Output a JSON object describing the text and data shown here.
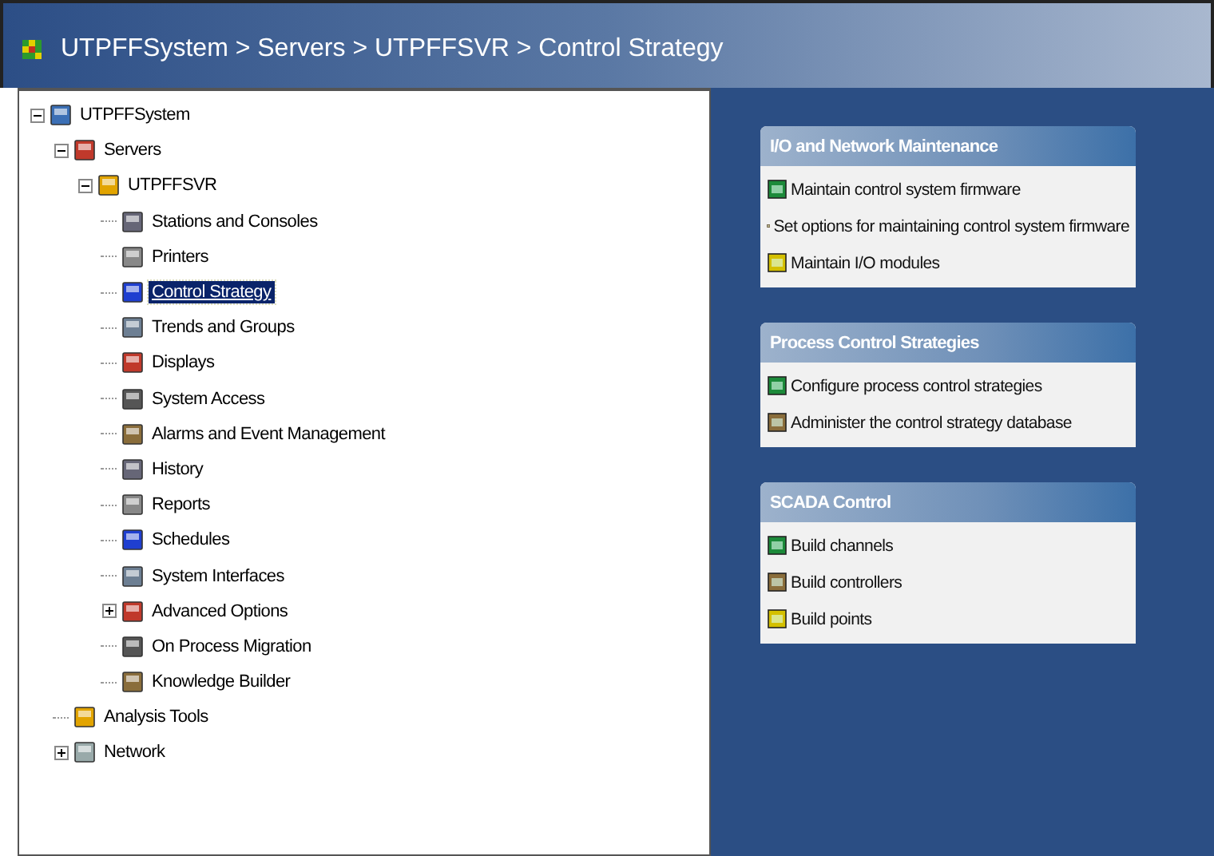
{
  "window": {
    "title": "UTPFFSystem > Servers > UTPFFSVR > Control Strategy"
  },
  "tree": [
    {
      "label": "UTPFFSystem",
      "expanded": true,
      "selected": false,
      "children": [
        {
          "label": "Servers",
          "expanded": true,
          "selected": false,
          "children": [
            {
              "label": "UTPFFSVR",
              "expanded": true,
              "selected": false,
              "children": [
                {
                  "label": "Stations and Consoles",
                  "selected": false
                },
                {
                  "label": "Printers",
                  "selected": false
                },
                {
                  "label": "Control Strategy",
                  "selected": true
                },
                {
                  "label": "Trends and Groups",
                  "selected": false
                },
                {
                  "label": "Displays",
                  "selected": false
                },
                {
                  "label": "System Access",
                  "selected": false
                },
                {
                  "label": "Alarms and Event Management",
                  "selected": false
                },
                {
                  "label": "History",
                  "selected": false
                },
                {
                  "label": "Reports",
                  "selected": false
                },
                {
                  "label": "Schedules",
                  "selected": false
                },
                {
                  "label": "System Interfaces",
                  "selected": false
                },
                {
                  "label": "Advanced Options",
                  "expanded": false,
                  "selected": false
                },
                {
                  "label": "On Process Migration",
                  "selected": false
                },
                {
                  "label": "Knowledge Builder",
                  "selected": false
                }
              ]
            }
          ]
        },
        {
          "label": "Analysis Tools",
          "selected": false
        },
        {
          "label": "Network",
          "expanded": false,
          "selected": false
        }
      ]
    }
  ],
  "panels": [
    {
      "title": "I/O and Network Maintenance",
      "links": [
        "Maintain control system firmware",
        "Set options for maintaining control system firmware",
        "Maintain I/O modules"
      ]
    },
    {
      "title": "Process Control Strategies",
      "links": [
        "Configure process control strategies",
        "Administer the control strategy database"
      ]
    },
    {
      "title": "SCADA Control",
      "links": [
        "Build channels",
        "Build controllers",
        "Build points"
      ]
    }
  ]
}
